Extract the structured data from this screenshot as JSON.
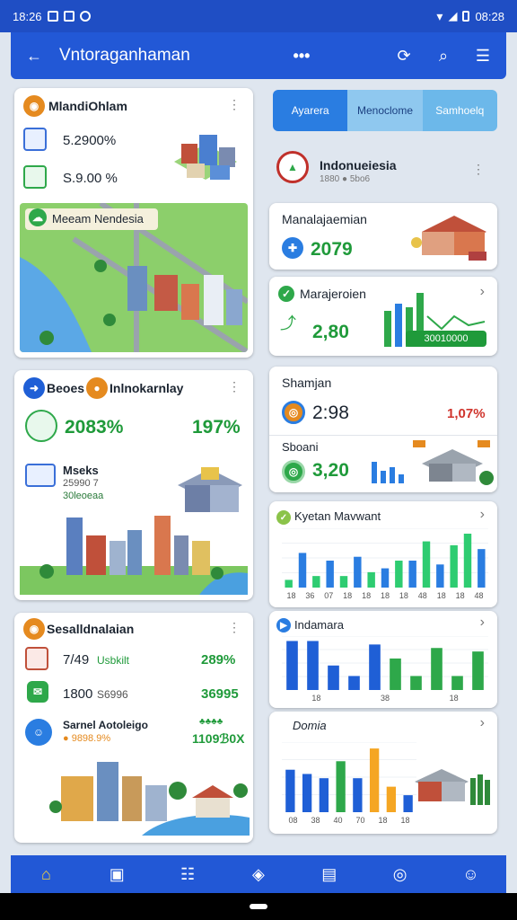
{
  "status_bar": {
    "time": "18:26",
    "right_time": "08:28"
  },
  "top_bar": {
    "title": "Vntoraganhaman",
    "more": "•••"
  },
  "card_region": {
    "title": "MlandiOhlam",
    "stat1": "5.2900%",
    "stat2": "S.9.00 %",
    "map_label": "Meeam Nendesia"
  },
  "card_beoes": {
    "title_a": "Beoes",
    "title_b": "Inlnokarnlay",
    "pct_a": "2083%",
    "pct_b": "197%",
    "sub_title": "Mseks",
    "sub_line": "25990 7",
    "sub_line2": "30leoeaa"
  },
  "card_sesal": {
    "title": "Sesalldnalaian",
    "r1_left": "7/49",
    "r1_mid": "Usbkilt",
    "r1_right": "289%",
    "r2_left": "1800",
    "r2_mid": "S6996",
    "r2_right": "36995",
    "r3_title": "Sarnel Aotoleigo",
    "r3_sub": "● 9898.9%",
    "r3_right": "1109ℬ0X",
    "r3_top": "♣♣♣♣"
  },
  "tabs": [
    {
      "label": "Ayarera",
      "color": "#2a7de1"
    },
    {
      "label": "Menoclome",
      "color": "#8fc8ef"
    },
    {
      "label": "Samhoelq",
      "color": "#6cb8ea"
    }
  ],
  "indo": {
    "title": "Indonueiesia",
    "sub": "1880 ● 5bo6"
  },
  "manal": {
    "title": "Manalajaemian",
    "value": "2079"
  },
  "marajer": {
    "title": "Marajeroien",
    "value": "2,80",
    "badge": "30010000"
  },
  "shamjan": {
    "title": "Shamjan",
    "value": "2:98",
    "pct": "1,07%",
    "sub_title": "Sboani",
    "sub_value": "3,20"
  },
  "kyetan": {
    "title": "Kyetan Mavwant"
  },
  "indamara": {
    "title": "Indamara"
  },
  "domia": {
    "title": "Domia"
  },
  "chart_data": [
    {
      "type": "bar",
      "title": "Kyetan Mavwant",
      "categories": [
        "18",
        "36",
        "07",
        "18",
        "18",
        "18",
        "18",
        "48",
        "18",
        "18",
        "48"
      ],
      "values": [
        2,
        9,
        3,
        7,
        3,
        8,
        4,
        5,
        7,
        7,
        12,
        6,
        11,
        14,
        10
      ],
      "colors": [
        "#2ecc71",
        "#2a7de1",
        "#2ecc71",
        "#2a7de1",
        "#2ecc71",
        "#2a7de1",
        "#2ecc71",
        "#2a7de1",
        "#2ecc71",
        "#2a7de1",
        "#2ecc71",
        "#2a7de1",
        "#2ecc71",
        "#2ecc71",
        "#2a7de1"
      ]
    },
    {
      "type": "bar",
      "title": "Indamara",
      "categories": [
        "18",
        "38",
        "18"
      ],
      "values": [
        14,
        14,
        7,
        4,
        13,
        9,
        4,
        12,
        4,
        11
      ],
      "colors": [
        "#1f5fd6",
        "#1f5fd6",
        "#1f5fd6",
        "#1f5fd6",
        "#1f5fd6",
        "#2ea84a",
        "#2ea84a",
        "#2ea84a",
        "#2ea84a",
        "#2ea84a"
      ]
    },
    {
      "type": "bar",
      "title": "Domia",
      "categories": [
        "08",
        "38",
        "40",
        "70",
        "18",
        "18"
      ],
      "values": [
        10,
        9,
        8,
        12,
        8,
        15,
        6,
        4
      ],
      "colors": [
        "#1f5fd6",
        "#1f5fd6",
        "#1f5fd6",
        "#2ea84a",
        "#1f5fd6",
        "#f5a623",
        "#f5a623",
        "#1f5fd6"
      ]
    }
  ]
}
